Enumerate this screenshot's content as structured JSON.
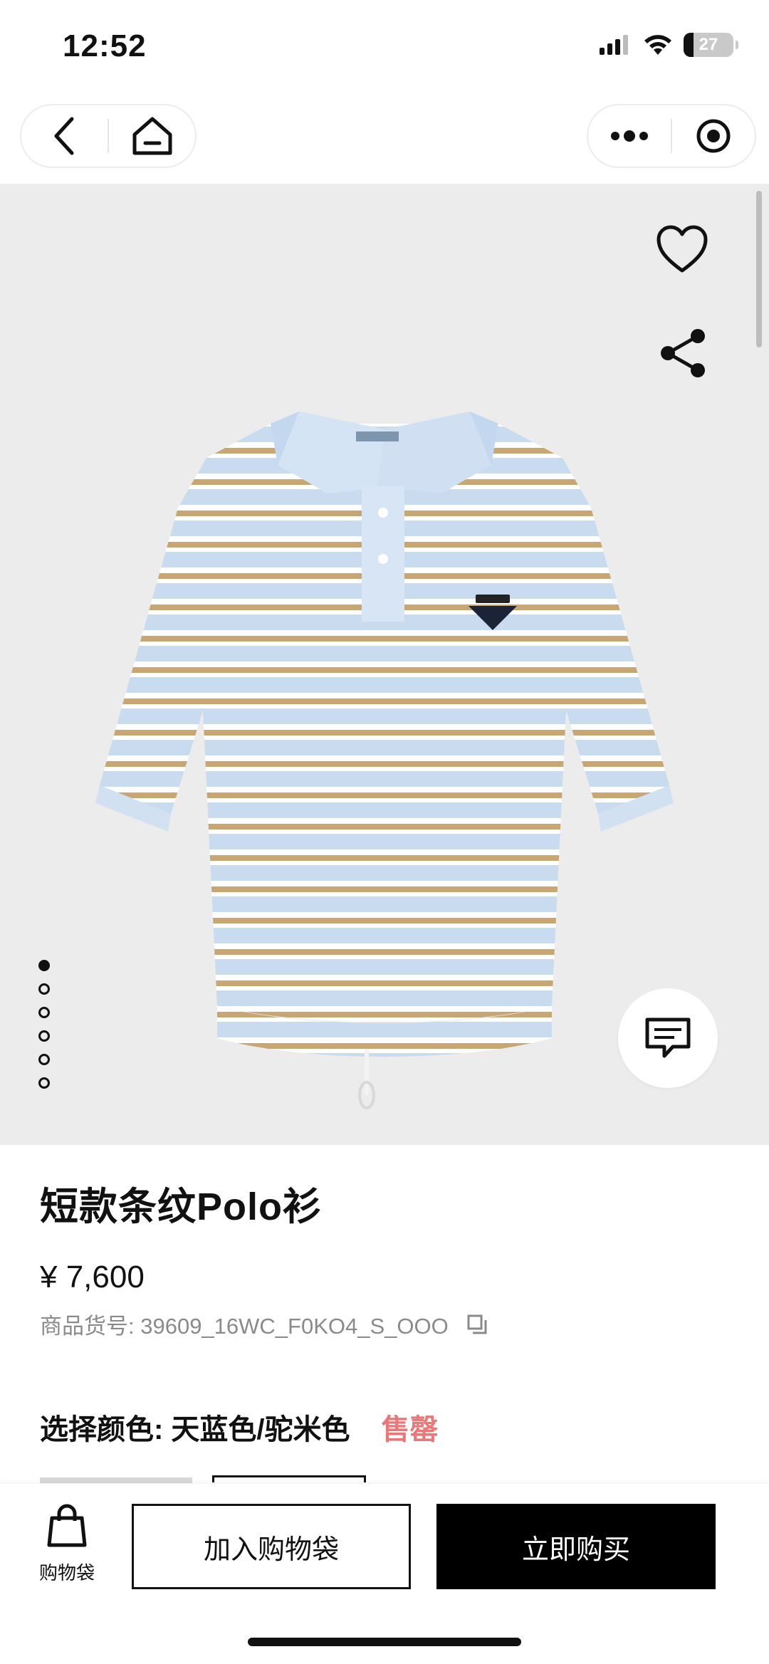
{
  "status_bar": {
    "time": "12:52",
    "battery": "27"
  },
  "product": {
    "title": "短款条纹Polo衫",
    "price": "¥ 7,600",
    "sku": "商品货号: 39609_16WC_F0KO4_S_OOO"
  },
  "color_select": {
    "label": "选择颜色: 天蓝色/驼米色",
    "status": "售罄"
  },
  "bottom_bar": {
    "bag_label": "购物袋",
    "add_to_bag": "加入购物袋",
    "buy_now": "立即购买"
  },
  "gallery": {
    "image_count": 6,
    "active_index": 0
  },
  "colors": {
    "sold_out": "#e9787a",
    "shirt_blue": "#c9dbef",
    "stripe_tan": "#c8a674"
  },
  "icons": [
    "back-icon",
    "home-icon",
    "more-icon",
    "target-icon",
    "heart-icon",
    "share-icon",
    "chat-icon",
    "bag-icon",
    "copy-icon"
  ]
}
